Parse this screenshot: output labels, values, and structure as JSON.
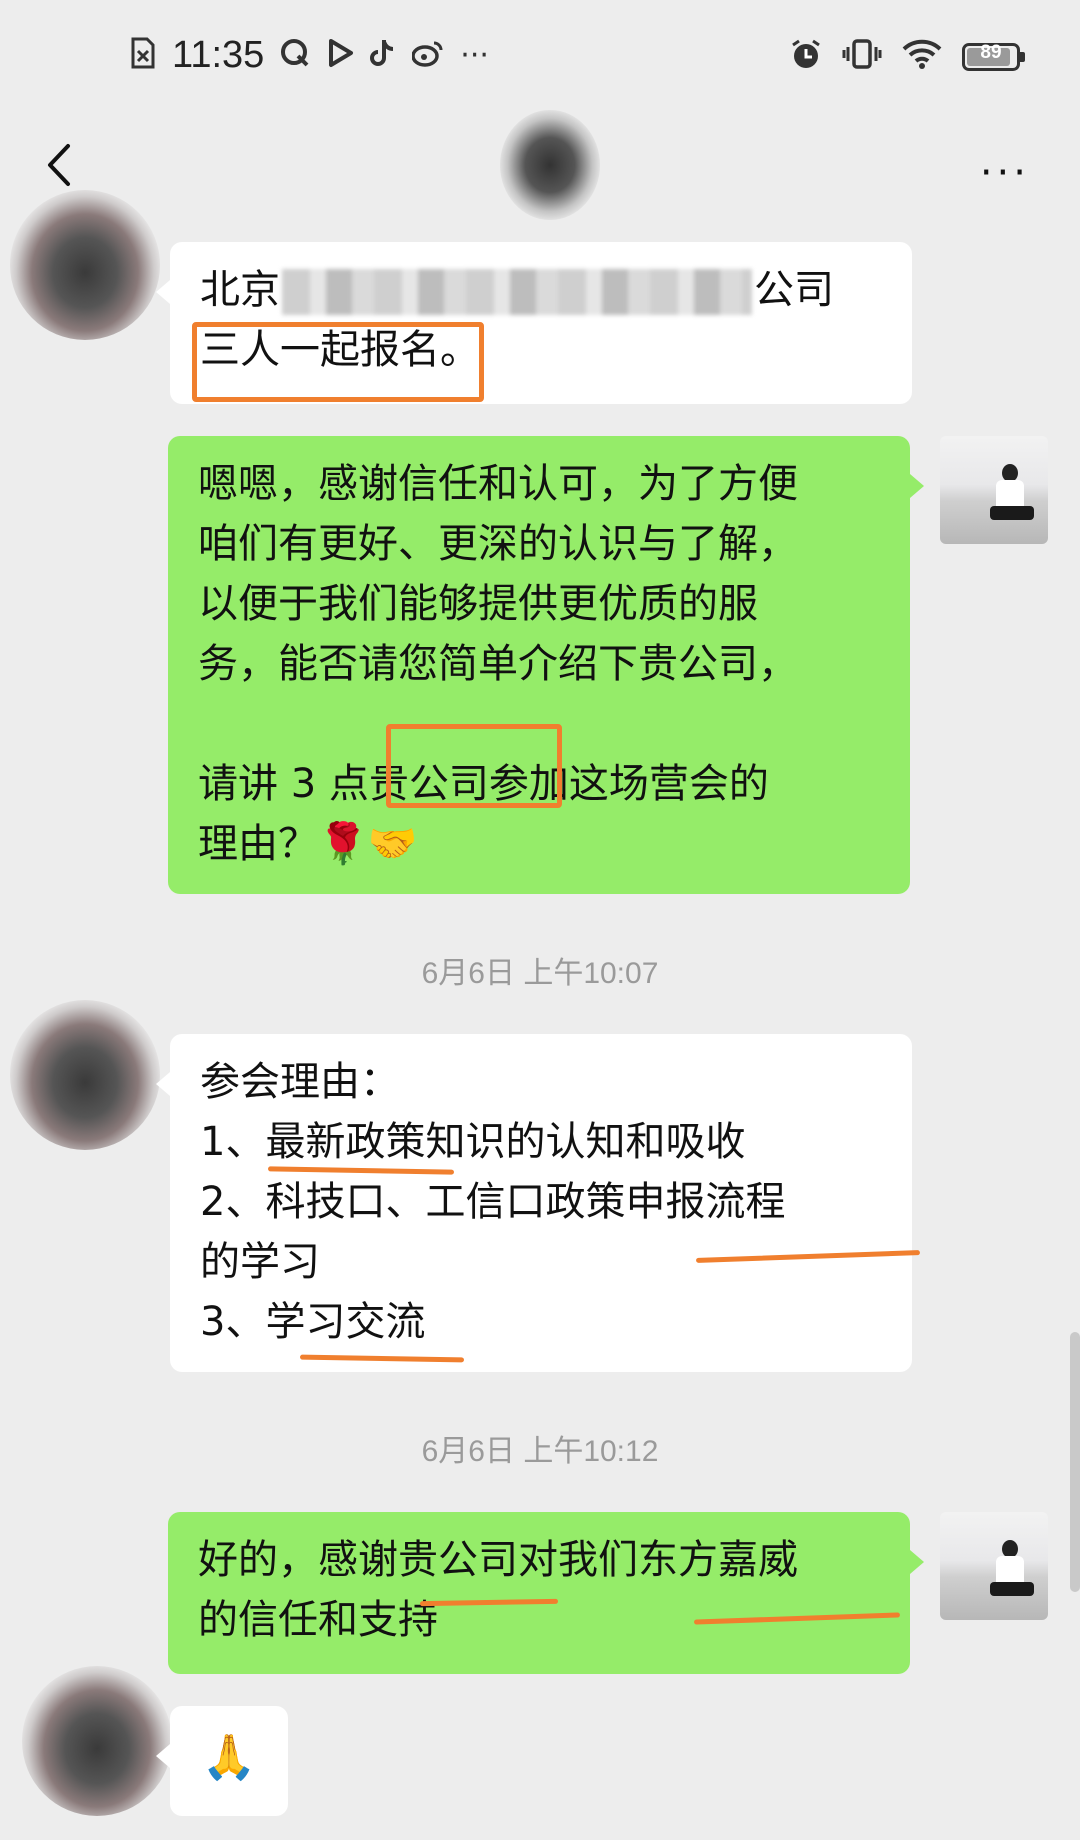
{
  "status_bar": {
    "time": "11:35",
    "left_icons": [
      "sim-icon",
      "q-app-icon",
      "play-icon",
      "tiktok-icon",
      "weibo-icon",
      "more-dots-icon"
    ],
    "right_icons": [
      "alarm-icon",
      "vibrate-icon",
      "wifi-icon"
    ],
    "battery": "89",
    "battery_level": 0.89
  },
  "nav": {
    "back_glyph": "‹",
    "more_glyph": "···"
  },
  "messages": {
    "m1": {
      "line1_a": "北京",
      "line1_b": "公司",
      "line2_a": "三人一起报名",
      "line2_b": "。"
    },
    "m2": {
      "l1": "嗯嗯，感谢信任和认可，为了方便",
      "l2": "咱们有更好、更深的认识与了解，",
      "l3": "以便于我们能够提供更优质的服",
      "l4": "务，能否请您简单介绍下贵公司，",
      "l5": "请讲 3 点贵公司参加这场营会的",
      "l6": "理由？🌹🤝"
    },
    "ts1": "6月6日 上午10:07",
    "m3": {
      "l1": "参会理由：",
      "l2": "1、最新政策知识的认知和吸收",
      "l3": "2、科技口、工信口政策申报流程",
      "l4": "的学习",
      "l5": "3、学习交流"
    },
    "ts2": "6月6日 上午10:12",
    "m4": {
      "l1": "好的，感谢贵公司对我们东方嘉威",
      "l2": "的信任和支持"
    },
    "m5": {
      "emoji": "🙏"
    }
  },
  "colors": {
    "background": "#ededed",
    "sent_bubble": "#95ec69",
    "received_bubble": "#ffffff",
    "annotation": "#f07f2e",
    "timestamp": "#9a9a9a"
  }
}
